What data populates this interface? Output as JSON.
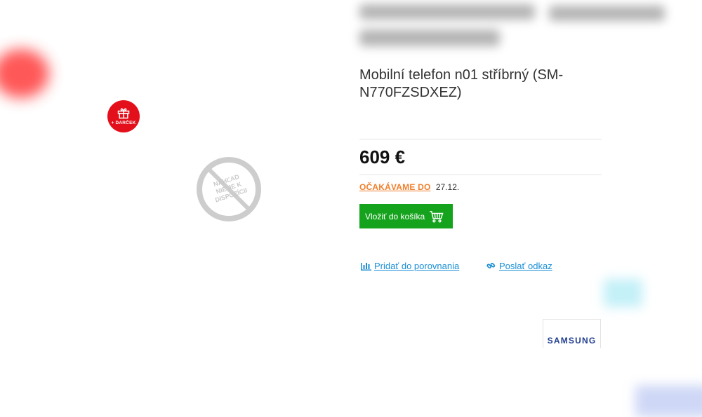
{
  "badge": {
    "label": "+ DARČEK",
    "color": "#e3101b"
  },
  "image_placeholder": {
    "lines": [
      "NÁHĽAD",
      "NIE JE K",
      "DISPOZÍCII"
    ]
  },
  "product": {
    "title": "Mobilní telefon n01 stříbrný (SM-N770FZSDXEZ)",
    "price": "609 €",
    "availability": {
      "status": "OČAKÁVAME DO",
      "date": "27.12."
    }
  },
  "actions": {
    "add_to_cart": "Vložiť do košíka",
    "compare": "Pridať do porovnania",
    "share": "Poslať odkaz"
  },
  "brand": {
    "logo_text": "SAMSUNG"
  },
  "colors": {
    "accent_green": "#15a31d",
    "link_blue": "#1a8fd6",
    "status_orange": "#f07f2b",
    "brand_blue": "#1f3c8f"
  },
  "icons": [
    "gift-icon",
    "no-image-icon",
    "cart-icon",
    "chart-icon",
    "link-icon"
  ]
}
